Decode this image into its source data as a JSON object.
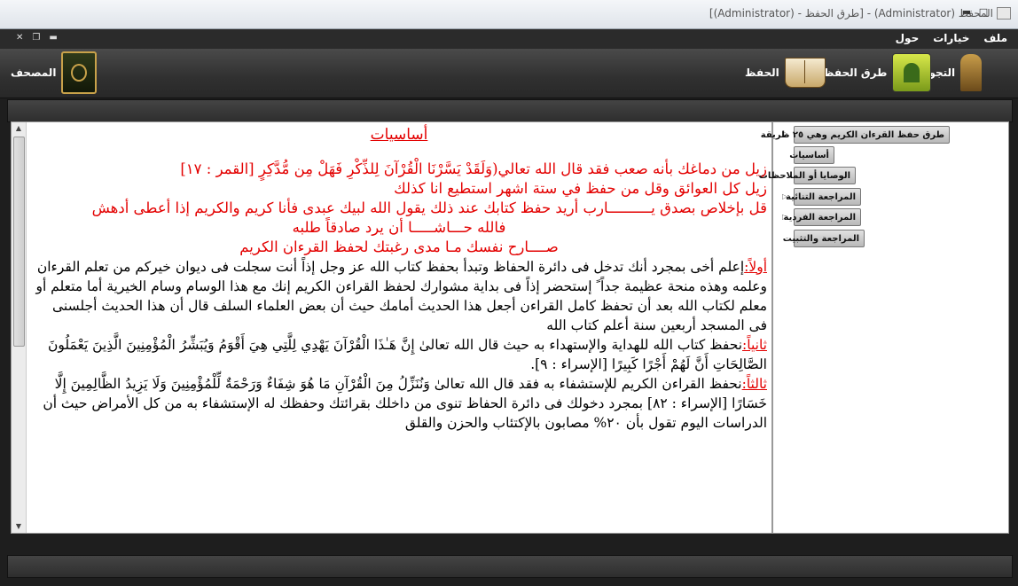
{
  "window": {
    "title": "[(Administrator) - طرق الحفظ] - (Administrator) المحفظ"
  },
  "menu": {
    "items": [
      "ملف",
      "خيارات",
      "حول"
    ]
  },
  "toolbar": {
    "buttons": [
      {
        "label": "التجويد",
        "icon": "mosque-icon"
      },
      {
        "label": "طرق الحفظ",
        "icon": "mosque-frame-icon"
      },
      {
        "label": "الحفظ",
        "icon": "open-book-icon"
      },
      {
        "label": "المصحف",
        "icon": "mushaf-icon"
      }
    ]
  },
  "document": {
    "heading": "أساسيات",
    "lines": [
      "زيل من دماغك بأنه صعب فقد قال الله تعالي(وَلَقَدْ يَسَّرْنَا الْقُرْآنَ لِلذِّكْرِ فَهَلْ مِن مُّدَّكِرٍ [القمر : ١٧]",
      "زيل كل العوائق وقل من حفظ في ستة اشهر استطيع انا كذلك",
      "قل بإخلاص بصدق يــــــــــارب أريد حفظ كتابك عند ذلك يقول الله لبيك عبدى فأنا كريم والكريم إذا أعطى أدهش",
      "فالله حـــاشـــــا أن يرد صادقاً طلبه",
      "صــــارح نفسك مـا مدى رغبتك لحفظ القرءان الكريم"
    ],
    "paragraphs": [
      {
        "label": "أولاً:",
        "text": "إعلم أخى بمجرد أنك تدخل فى دائرة الحفاظ وتبدأ بحفظ كتاب الله عز وجل إذاً أنت سجلت فى ديوان خيركم من تعلم القرءان وعلمه وهذه منحة عظيمة جداً ً إستحضر إذاً فى بداية مشوارك لحفظ القراءن الكريم إنك مع هذا الوسام وسام الخيرية أما متعلم أو معلم لكتاب الله بعد أن تحفظ كامل القراءن أجعل هذا الحديث أمامك حيث أن بعض العلماء السلف قال أن هذا الحديث أجلسنى فى المسجد أربعين سنة أعلم كتاب الله"
      },
      {
        "label": "ثانياً:",
        "text": "نحفظ كتاب الله للهداية والإستهداء به حيث قال الله تعالىٰ إِنَّ هَـٰذَا الْقُرْآنَ يَهْدِي لِلَّتِي هِيَ أَقْوَمُ وَيُبَشِّرُ الْمُؤْمِنِينَ الَّذِينَ يَعْمَلُونَ الصَّالِحَاتِ أَنَّ لَهُمْ أَجْرًا كَبِيرًا [الإسراء : ٩]."
      },
      {
        "label": "ثالثاً:",
        "text": "نحفظ القراءن الكريم للإستشفاء به فقد قال الله تعالىٰ وَنُنَزِّلُ مِنَ الْقُرْآنِ مَا هُوَ شِفَاءٌ وَرَحْمَةٌ لِّلْمُؤْمِنِينَ وَلَا يَزِيدُ الظَّالِمِينَ إِلَّا خَسَارًا [الإسراء : ٨٢] بمجرد دخولك فى دائرة الحفاظ تنوى من داخلك بقرائتك وحفظك له الإستشفاء به من كل الأمراض حيث أن الدراسات اليوم تقول بأن ٢٠% مصابون بالإكتئاب والحزن والقلق"
      }
    ]
  },
  "tree": {
    "nodes": [
      {
        "label": "طرق حفظ القرءان الكريم وهي ٢٥ طريقة",
        "expandable": true
      },
      {
        "label": "أساسيات",
        "expandable": false
      },
      {
        "label": "الوصايا أو الملاحظات",
        "expandable": false
      },
      {
        "label": "المراجعة التنائية",
        "expandable": true
      },
      {
        "label": "المراجعة الفردية",
        "expandable": true
      },
      {
        "label": "المراجعة والتثبيت",
        "expandable": false
      }
    ]
  }
}
